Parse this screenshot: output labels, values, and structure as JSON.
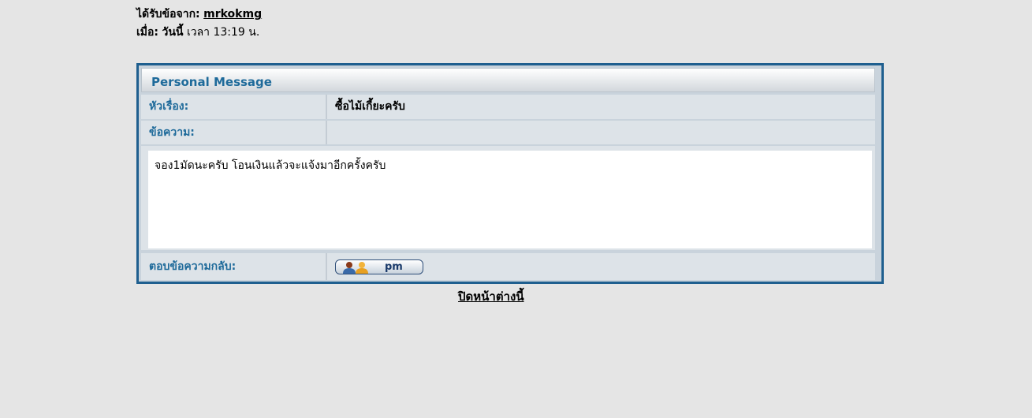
{
  "header_info": {
    "from_label": "ได้รับข้อจาก:",
    "from_user": "mrkokmg",
    "when_label": "เมื่อ:",
    "when_day": "วันนี้",
    "when_time": "เวลา 13:19 น."
  },
  "pm": {
    "title": "Personal Message",
    "subject_label": "หัวเรื่อง:",
    "subject_value": "ซื้อไม้เกี้ยะครับ",
    "message_label": "ข้อความ:",
    "message_body": "จอง1มัดนะครับ โอนเงินแล้วจะแจ้งมาอีกครั้งครับ",
    "reply_label": "ตอบข้อความกลับ:",
    "reply_button_label": "pm"
  },
  "footer": {
    "close_link": "ปิดหน้าต่างนี้"
  },
  "colors": {
    "accent": "#1e6a9a",
    "border": "#1f5f8f",
    "page_bg": "#e5e5e5"
  }
}
